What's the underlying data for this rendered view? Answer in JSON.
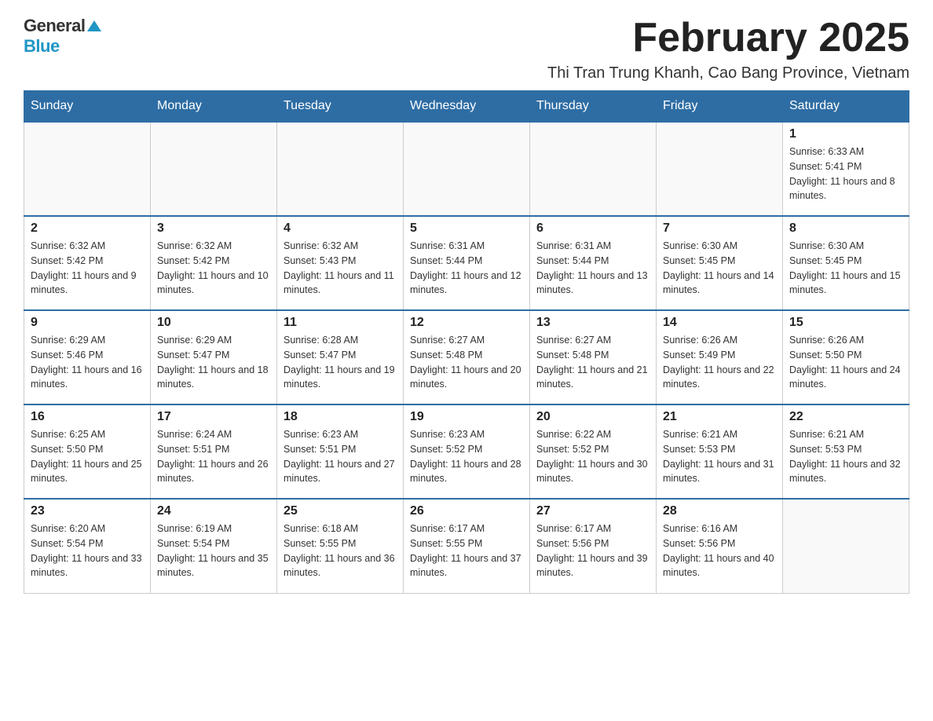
{
  "header": {
    "logo_general": "General",
    "logo_blue": "Blue",
    "month_title": "February 2025",
    "location": "Thi Tran Trung Khanh, Cao Bang Province, Vietnam"
  },
  "calendar": {
    "days_of_week": [
      "Sunday",
      "Monday",
      "Tuesday",
      "Wednesday",
      "Thursday",
      "Friday",
      "Saturday"
    ],
    "weeks": [
      {
        "days": [
          {
            "number": "",
            "info": ""
          },
          {
            "number": "",
            "info": ""
          },
          {
            "number": "",
            "info": ""
          },
          {
            "number": "",
            "info": ""
          },
          {
            "number": "",
            "info": ""
          },
          {
            "number": "",
            "info": ""
          },
          {
            "number": "1",
            "info": "Sunrise: 6:33 AM\nSunset: 5:41 PM\nDaylight: 11 hours and 8 minutes."
          }
        ]
      },
      {
        "days": [
          {
            "number": "2",
            "info": "Sunrise: 6:32 AM\nSunset: 5:42 PM\nDaylight: 11 hours and 9 minutes."
          },
          {
            "number": "3",
            "info": "Sunrise: 6:32 AM\nSunset: 5:42 PM\nDaylight: 11 hours and 10 minutes."
          },
          {
            "number": "4",
            "info": "Sunrise: 6:32 AM\nSunset: 5:43 PM\nDaylight: 11 hours and 11 minutes."
          },
          {
            "number": "5",
            "info": "Sunrise: 6:31 AM\nSunset: 5:44 PM\nDaylight: 11 hours and 12 minutes."
          },
          {
            "number": "6",
            "info": "Sunrise: 6:31 AM\nSunset: 5:44 PM\nDaylight: 11 hours and 13 minutes."
          },
          {
            "number": "7",
            "info": "Sunrise: 6:30 AM\nSunset: 5:45 PM\nDaylight: 11 hours and 14 minutes."
          },
          {
            "number": "8",
            "info": "Sunrise: 6:30 AM\nSunset: 5:45 PM\nDaylight: 11 hours and 15 minutes."
          }
        ]
      },
      {
        "days": [
          {
            "number": "9",
            "info": "Sunrise: 6:29 AM\nSunset: 5:46 PM\nDaylight: 11 hours and 16 minutes."
          },
          {
            "number": "10",
            "info": "Sunrise: 6:29 AM\nSunset: 5:47 PM\nDaylight: 11 hours and 18 minutes."
          },
          {
            "number": "11",
            "info": "Sunrise: 6:28 AM\nSunset: 5:47 PM\nDaylight: 11 hours and 19 minutes."
          },
          {
            "number": "12",
            "info": "Sunrise: 6:27 AM\nSunset: 5:48 PM\nDaylight: 11 hours and 20 minutes."
          },
          {
            "number": "13",
            "info": "Sunrise: 6:27 AM\nSunset: 5:48 PM\nDaylight: 11 hours and 21 minutes."
          },
          {
            "number": "14",
            "info": "Sunrise: 6:26 AM\nSunset: 5:49 PM\nDaylight: 11 hours and 22 minutes."
          },
          {
            "number": "15",
            "info": "Sunrise: 6:26 AM\nSunset: 5:50 PM\nDaylight: 11 hours and 24 minutes."
          }
        ]
      },
      {
        "days": [
          {
            "number": "16",
            "info": "Sunrise: 6:25 AM\nSunset: 5:50 PM\nDaylight: 11 hours and 25 minutes."
          },
          {
            "number": "17",
            "info": "Sunrise: 6:24 AM\nSunset: 5:51 PM\nDaylight: 11 hours and 26 minutes."
          },
          {
            "number": "18",
            "info": "Sunrise: 6:23 AM\nSunset: 5:51 PM\nDaylight: 11 hours and 27 minutes."
          },
          {
            "number": "19",
            "info": "Sunrise: 6:23 AM\nSunset: 5:52 PM\nDaylight: 11 hours and 28 minutes."
          },
          {
            "number": "20",
            "info": "Sunrise: 6:22 AM\nSunset: 5:52 PM\nDaylight: 11 hours and 30 minutes."
          },
          {
            "number": "21",
            "info": "Sunrise: 6:21 AM\nSunset: 5:53 PM\nDaylight: 11 hours and 31 minutes."
          },
          {
            "number": "22",
            "info": "Sunrise: 6:21 AM\nSunset: 5:53 PM\nDaylight: 11 hours and 32 minutes."
          }
        ]
      },
      {
        "days": [
          {
            "number": "23",
            "info": "Sunrise: 6:20 AM\nSunset: 5:54 PM\nDaylight: 11 hours and 33 minutes."
          },
          {
            "number": "24",
            "info": "Sunrise: 6:19 AM\nSunset: 5:54 PM\nDaylight: 11 hours and 35 minutes."
          },
          {
            "number": "25",
            "info": "Sunrise: 6:18 AM\nSunset: 5:55 PM\nDaylight: 11 hours and 36 minutes."
          },
          {
            "number": "26",
            "info": "Sunrise: 6:17 AM\nSunset: 5:55 PM\nDaylight: 11 hours and 37 minutes."
          },
          {
            "number": "27",
            "info": "Sunrise: 6:17 AM\nSunset: 5:56 PM\nDaylight: 11 hours and 39 minutes."
          },
          {
            "number": "28",
            "info": "Sunrise: 6:16 AM\nSunset: 5:56 PM\nDaylight: 11 hours and 40 minutes."
          },
          {
            "number": "",
            "info": ""
          }
        ]
      }
    ]
  }
}
